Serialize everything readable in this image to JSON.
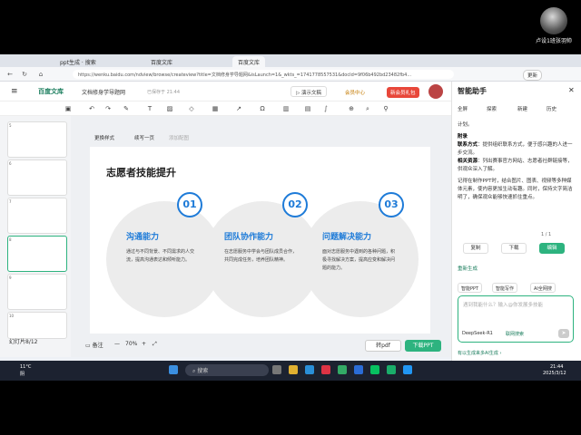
{
  "camera": {
    "label": "卢设1班张羽帅"
  },
  "browser": {
    "tabs": [
      {
        "label": "ppt生成 · 搜索"
      },
      {
        "label": "百度文库"
      },
      {
        "label": "百度文库"
      }
    ],
    "url": "https://wenku.baidu.com/ndview/browse/createview?title=文档修身学导题网&isLaunch=1&_wkts_=1741778557531&docId=9f06b492bd23482fb4...",
    "right_label": "更新"
  },
  "app": {
    "logo": "百度文库",
    "doc_title": "文档修身学导题网",
    "save_time": "已保存于 21:44",
    "buttons": {
      "present": "演示文稿",
      "member": "会员中心",
      "new_user": "新会员礼包"
    }
  },
  "canvas_tools": {
    "change_style": "更换样式",
    "continue": "续写一页",
    "insert": "添加配图"
  },
  "slides_panel": {
    "thumbs": [
      {
        "num": "5"
      },
      {
        "num": "6"
      },
      {
        "num": "7"
      },
      {
        "num": "8"
      },
      {
        "num": "9"
      },
      {
        "num": "10"
      }
    ],
    "count_label": "幻灯片8/12"
  },
  "slide": {
    "title": "志愿者技能提升",
    "cards": [
      {
        "num": "01",
        "title": "沟通能力",
        "desc": "通过与不同背景、不同需求的人交流，提高沟通表达和倾听能力。"
      },
      {
        "num": "02",
        "title": "团队协作能力",
        "desc": "在志愿服务中学会与团队成员合作，共同完成任务，培养团队精神。"
      },
      {
        "num": "03",
        "title": "问题解决能力",
        "desc": "面对志愿服务中遇到的各种问题，积极寻找解决方案，提高应变和解决问题的能力。"
      }
    ]
  },
  "bottom": {
    "notes": "备注",
    "zoom": "70%",
    "to_ppt": "转pdf",
    "download": "下载PPT"
  },
  "assistant": {
    "title": "智能助手",
    "tabs": [
      "全屏",
      "探索",
      "新建",
      "历史"
    ],
    "body_top": "计划。",
    "appendix_label": "附录",
    "contact_label": "联系方式",
    "contact_text": "：提供组织联系方式，便于感兴趣的人进一步交流。",
    "resource_label": "相关资源",
    "resource_text": "：列出赛事官方网站、志愿者社群链接等，供观众深入了解。",
    "tip": "记得在制作PPT时，结合图片、图表、视频等多种媒体元素，使内容更加生动有趣。同时，保持文字简洁明了，确保观众能够快速抓住重点。",
    "pager": "1 / 1",
    "btn_copy": "复制",
    "btn_download": "下载",
    "btn_edit": "编辑",
    "regen": "重新生成",
    "chips": [
      "智能PPT",
      "智能写作",
      "AI全网搜"
    ],
    "input_placeholder": "遇到我能什么？输入@你发展多技能",
    "model": "DeepSeek-R1",
    "web_search": "联网搜索",
    "footer": "有以生成来多AI生成 ›"
  },
  "taskbar": {
    "weather_temp": "11°C",
    "weather_desc": "阴",
    "search": "搜索",
    "time": "21:44",
    "date": "2025/3/12"
  }
}
